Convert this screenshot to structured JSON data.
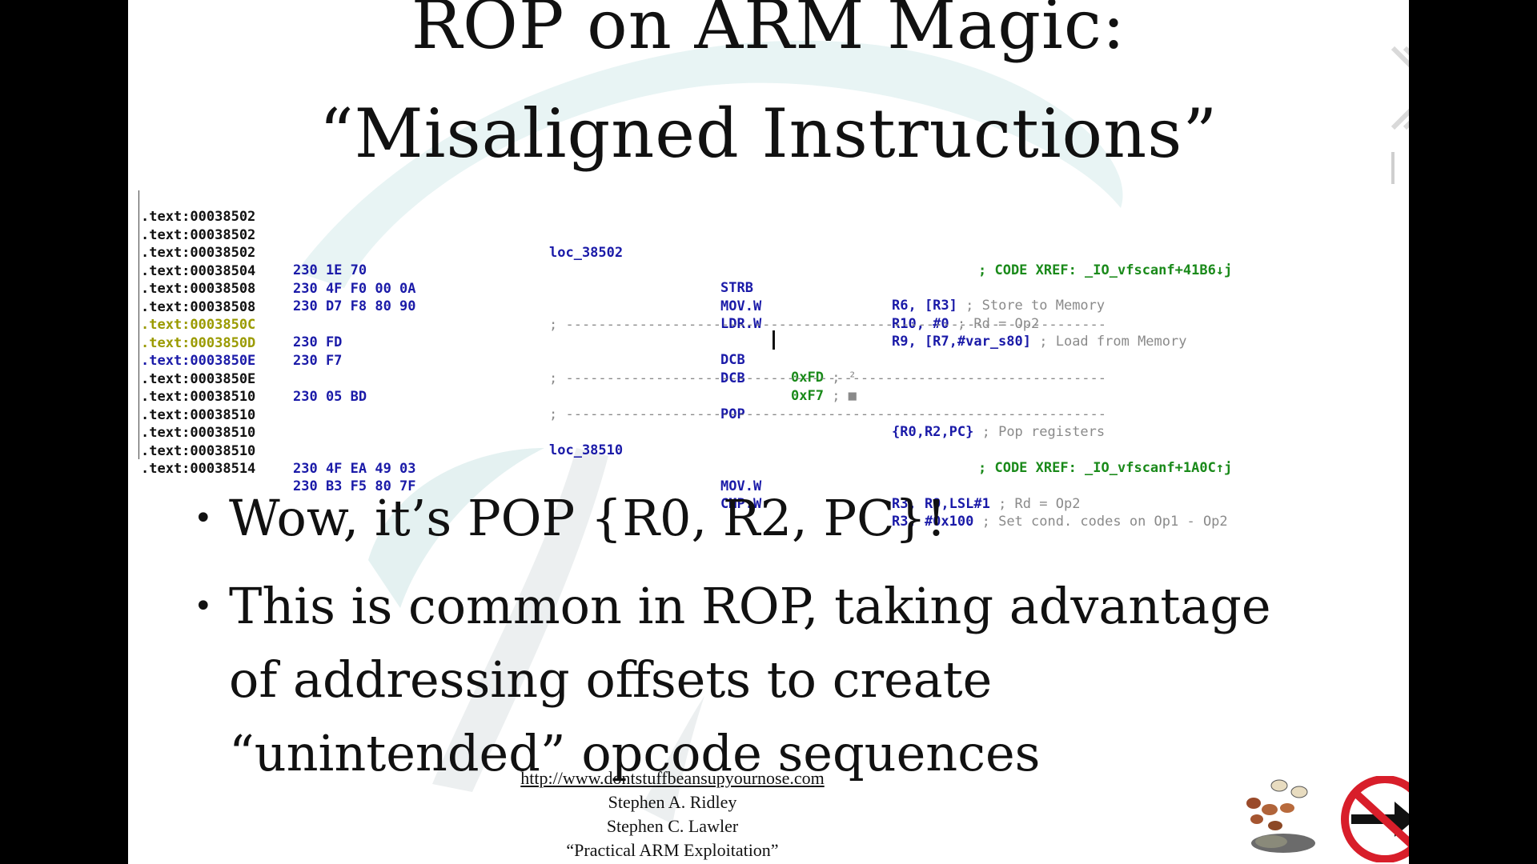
{
  "slide": {
    "title_line1": "ROP on ARM Magic:",
    "title_line2": "“Misaligned Instructions”"
  },
  "disasm": {
    "rows": [
      {
        "addr": ".text:00038502"
      },
      {
        "addr": ".text:00038502",
        "label": "loc_38502",
        "xref": "; CODE XREF: _IO_vfscanf+41B6↓j"
      },
      {
        "addr": ".text:00038502",
        "bytes": "230 1E 70",
        "mnem": "STRB",
        "ops": "R6, [R3]",
        "comment": "; Store to Memory"
      },
      {
        "addr": ".text:00038504",
        "bytes": "230 4F F0 00 0A",
        "mnem": "MOV.W",
        "ops": "R10, #0",
        "comment": "; Rd = Op2"
      },
      {
        "addr": ".text:00038508",
        "bytes": "230 D7 F8 80 90",
        "mnem": "LDR.W",
        "ops": "R9, [R7,#var_s80]",
        "comment": "; Load from Memory"
      },
      {
        "addr": ".text:00038508",
        "sep": "; ------------------------------------------------------------------"
      },
      {
        "addr": ".text:0003850C",
        "bytes": "230 FD",
        "mnem": "DCB",
        "ops": "0xFD",
        "comment": "; ²"
      },
      {
        "addr": ".text:0003850D",
        "bytes": "230 F7",
        "mnem": "DCB",
        "ops": "0xF7",
        "comment": "; ■"
      },
      {
        "addr": ".text:0003850E",
        "sep": "; ------------------------------------------------------------------"
      },
      {
        "addr": ".text:0003850E",
        "bytes": "230 05 BD",
        "mnem": "POP",
        "ops": "{R0,R2,PC}",
        "comment": "; Pop registers"
      },
      {
        "addr": ".text:00038510",
        "sep": "; ------------------------------------------------------------------"
      },
      {
        "addr": ".text:00038510"
      },
      {
        "addr": ".text:00038510",
        "label": "loc_38510",
        "xref": "; CODE XREF: _IO_vfscanf+1A0C↑j"
      },
      {
        "addr": ".text:00038510",
        "bytes": "230 4F EA 49 03",
        "mnem": "MOV.W",
        "ops": "R3, R9,LSL#1",
        "comment": "; Rd = Op2"
      },
      {
        "addr": ".text:00038514",
        "bytes": "230 B3 F5 80 7F",
        "mnem": "CMP.W",
        "ops": "R3, #0x100",
        "comment": "; Set cond. codes on Op1 - Op2"
      }
    ]
  },
  "bullets": {
    "b1": "Wow, it’s POP {R0, R2, PC}!",
    "b2_line1": "This is common in ROP, taking advantage",
    "b2_line2": "of addressing offsets to create",
    "b2_line3": "“unintended” opcode sequences"
  },
  "footer": {
    "url": "http://www.dontstuffbeansupyournose.com",
    "author1": "Stephen A. Ridley",
    "author2": "Stephen C. Lawler",
    "talk": "“Practical ARM Exploitation”"
  },
  "colors": {
    "background": "#ffffff",
    "frame": "#000000",
    "code_blue": "#1a1aa8",
    "code_green": "#1a8a1a",
    "code_yellow": "#9a9a00",
    "code_gray": "#8a8a8a",
    "no_sign_red": "#d81e2a"
  },
  "icons": {
    "top_right_logo": "conference-logo",
    "bottom_icons": [
      "beans-icon",
      "no-entry-arrow-icon",
      "nose-icon"
    ]
  }
}
